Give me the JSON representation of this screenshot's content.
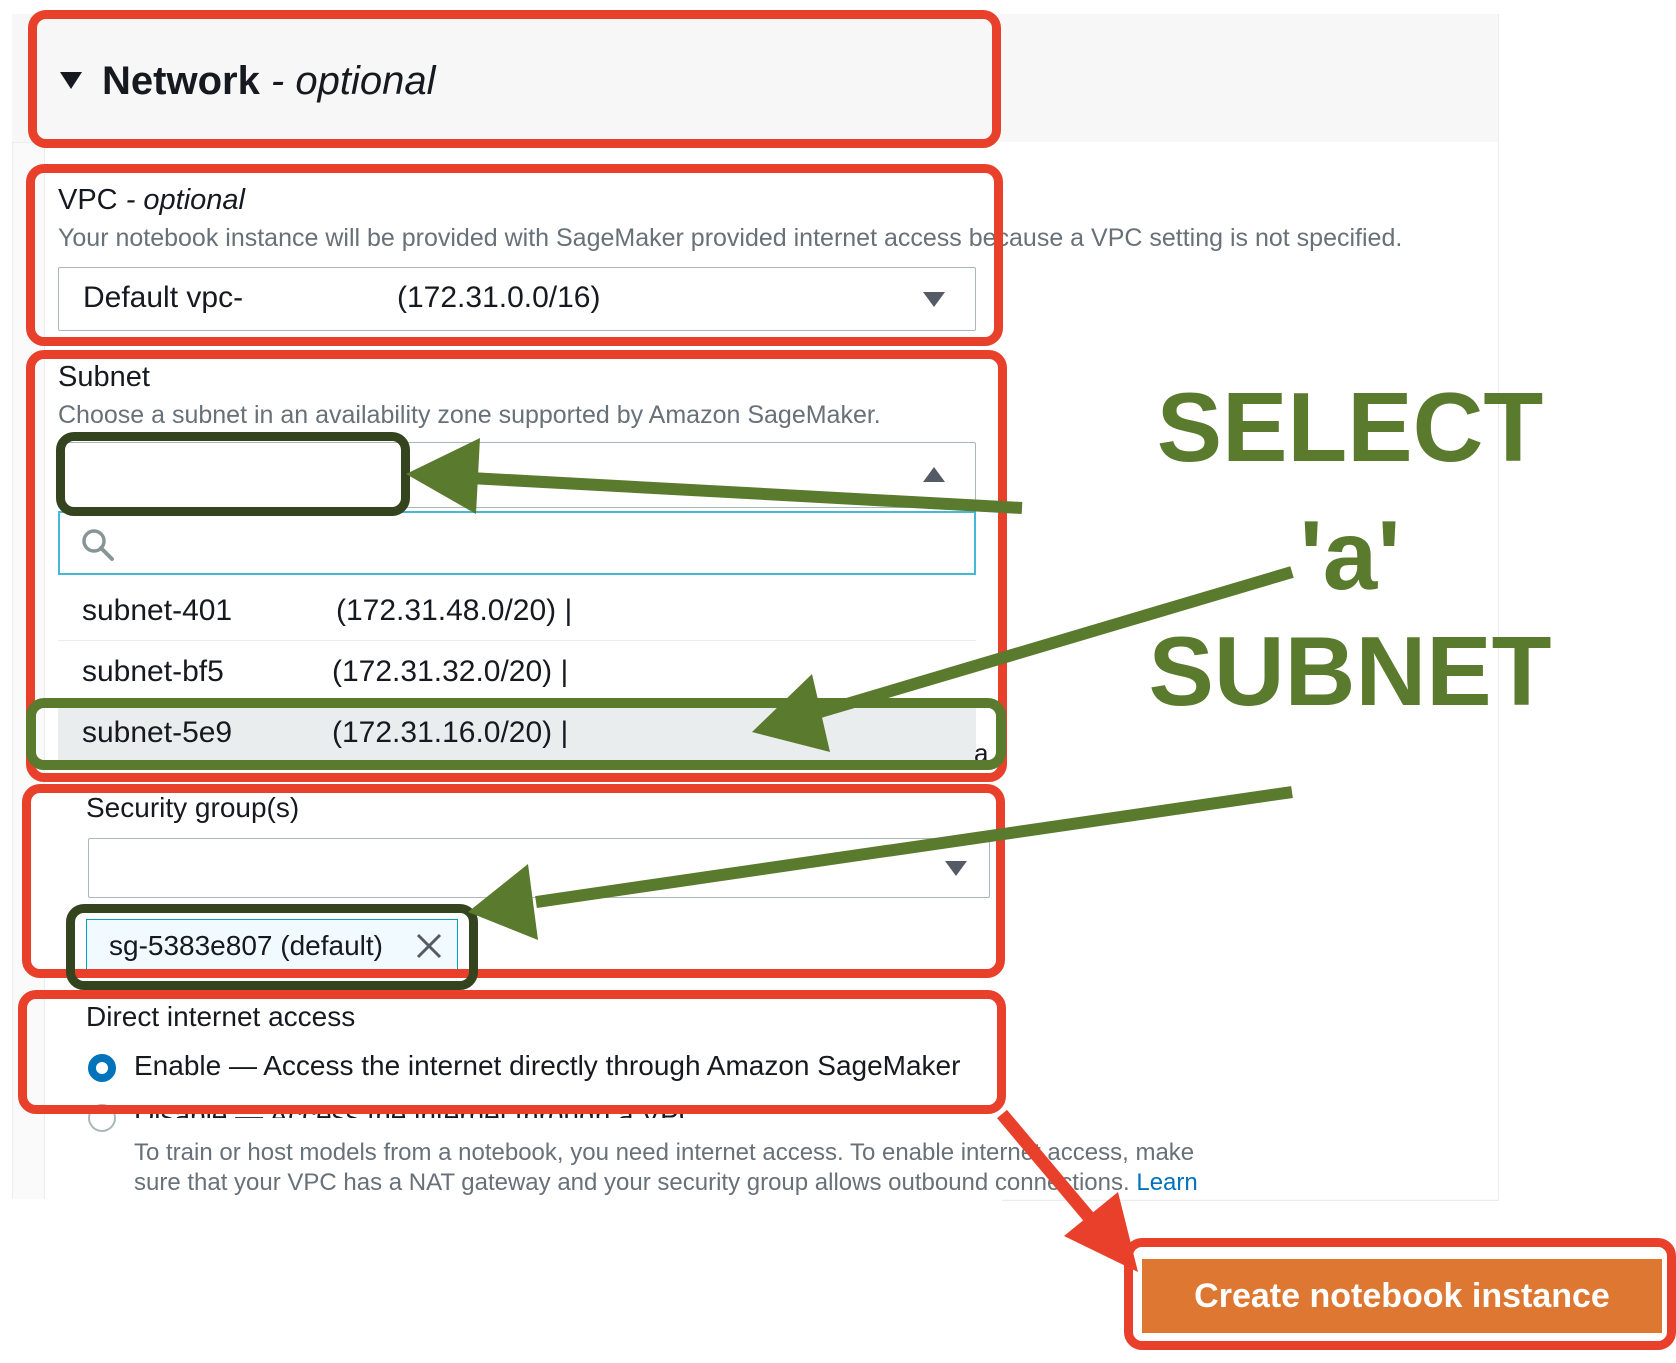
{
  "network": {
    "title": "Network",
    "title_suffix": " - optional"
  },
  "vpc": {
    "label": "VPC",
    "label_suffix": " - optional",
    "description": "Your notebook instance will be provided with SageMaker provided internet access because a VPC setting is not specified.",
    "selected_name": "Default vpc-",
    "selected_cidr": "(172.31.0.0/16)"
  },
  "subnet": {
    "label": "Subnet",
    "description": "Choose a subnet in an availability zone supported by Amazon SageMaker.",
    "search_placeholder": "",
    "options": [
      {
        "id": "subnet-401",
        "cidr": "(172.31.48.0/20) |"
      },
      {
        "id": "subnet-bf5",
        "cidr": "(172.31.32.0/20) |"
      },
      {
        "id": "subnet-5e9",
        "cidr": "(172.31.16.0/20) |"
      }
    ],
    "clipped_char": "a"
  },
  "security_groups": {
    "label": "Security group(s)",
    "token": "sg-5383e807 (default)"
  },
  "internet_access": {
    "label": "Direct internet access",
    "enable_option": "Enable — Access the internet directly through Amazon SageMaker",
    "disable_option": "Disable — Access the internet through a VPC",
    "help_line1": "To train or host models from a notebook, you need internet access. To enable internet access, make",
    "help_line2": "sure that your VPC has a NAT gateway and your security group allows outbound connections.",
    "learn_link": "Learn"
  },
  "actions": {
    "create_label": "Create notebook instance"
  },
  "annotation": {
    "line1": "SELECT",
    "line2": "'a'",
    "line3": "SUBNET"
  },
  "colors": {
    "annotation_red": "#e8402a",
    "annotation_green": "#5a7a2e",
    "primary_button": "#dd7732",
    "link": "#0073bb"
  }
}
